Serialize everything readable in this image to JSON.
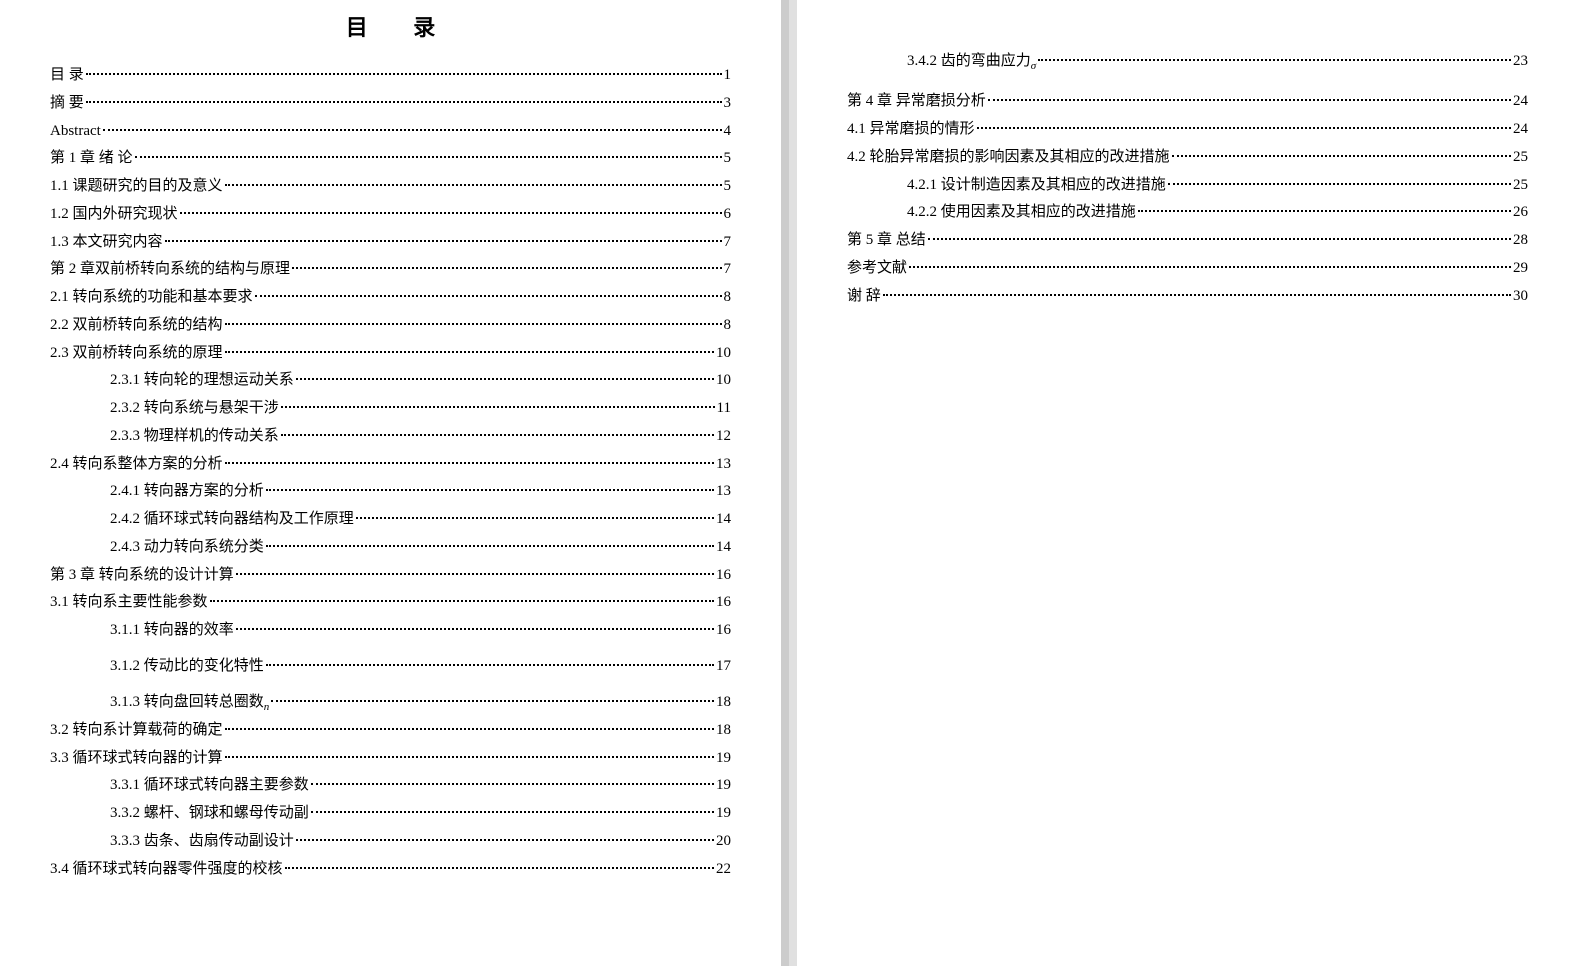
{
  "toc_title": "目 录",
  "left_page": [
    {
      "level": 1,
      "label": "目  录",
      "page": "1"
    },
    {
      "level": 1,
      "label": "摘  要",
      "page": "3"
    },
    {
      "level": 1,
      "label": "Abstract",
      "page": "4",
      "en": true
    },
    {
      "level": 1,
      "label": "第 1 章  绪  论",
      "page": "5"
    },
    {
      "level": 1,
      "label": "1.1 课题研究的目的及意义",
      "page": "5"
    },
    {
      "level": 1,
      "label": "1.2 国内外研究现状",
      "page": "6"
    },
    {
      "level": 1,
      "label": "1.3 本文研究内容",
      "page": "7"
    },
    {
      "level": 1,
      "label": "第 2 章双前桥转向系统的结构与原理",
      "page": "7"
    },
    {
      "level": 1,
      "label": "2.1 转向系统的功能和基本要求",
      "page": "8"
    },
    {
      "level": 1,
      "label": "2.2  双前桥转向系统的结构",
      "page": "8"
    },
    {
      "level": 1,
      "label": "2.3 双前桥转向系统的原理",
      "page": "10"
    },
    {
      "level": 2,
      "label": "2.3.1 转向轮的理想运动关系",
      "page": "10"
    },
    {
      "level": 2,
      "label": "2.3.2 转向系统与悬架干涉",
      "page": "11"
    },
    {
      "level": 2,
      "label": "2.3.3 物理样机的传动关系",
      "page": "12"
    },
    {
      "level": 1,
      "label": "2.4 转向系整体方案的分析",
      "page": "13"
    },
    {
      "level": 2,
      "label": "2.4.1 转向器方案的分析",
      "page": "13"
    },
    {
      "level": 2,
      "label": "2.4.2 循环球式转向器结构及工作原理",
      "page": "14"
    },
    {
      "level": 2,
      "label": "2.4.3 动力转向系统分类",
      "page": "14"
    },
    {
      "level": 1,
      "label": "第 3 章  转向系统的设计计算",
      "page": "16"
    },
    {
      "level": 1,
      "label": "3.1 转向系主要性能参数",
      "page": "16"
    },
    {
      "level": 2,
      "label": "3.1.1 转向器的效率",
      "page": "16"
    },
    {
      "level": 2,
      "label": "3.1.2 传动比的变化特性",
      "page": "17",
      "extra_margin": true
    },
    {
      "level": 2,
      "label": "3.1.3 转向盘回转总圈数",
      "sub": "n",
      "page": "18",
      "extra_margin": true
    },
    {
      "level": 1,
      "label": "3.2 转向系计算载荷的确定",
      "page": "18"
    },
    {
      "level": 1,
      "label": "3.3 循环球式转向器的计算",
      "page": "19"
    },
    {
      "level": 2,
      "label": "3.3.1 循环球式转向器主要参数",
      "page": "19"
    },
    {
      "level": 2,
      "label": "3.3.2 螺杆、钢球和螺母传动副",
      "page": "19"
    },
    {
      "level": 2,
      "label": "3.3.3 齿条、齿扇传动副设计",
      "page": "20"
    },
    {
      "level": 1,
      "label": "3.4 循环球式转向器零件强度的校核",
      "page": "22"
    }
  ],
  "right_page": [
    {
      "level": 2,
      "label": "3.4.2 齿的弯曲应力",
      "sub": "σ",
      "page": "23",
      "extra_margin": true
    },
    {
      "level": 1,
      "label": "第 4 章  异常磨损分析",
      "page": "24",
      "top_margin": true
    },
    {
      "level": 1,
      "label": "4.1 异常磨损的情形",
      "page": "24"
    },
    {
      "level": 1,
      "label": "4.2 轮胎异常磨损的影响因素及其相应的改进措施",
      "page": "25"
    },
    {
      "level": 2,
      "label": "4.2.1 设计制造因素及其相应的改进措施",
      "page": "25"
    },
    {
      "level": 2,
      "label": "4.2.2 使用因素及其相应的改进措施",
      "page": "26"
    },
    {
      "level": 1,
      "label": "第 5 章  总结",
      "page": "28"
    },
    {
      "level": 1,
      "label": "参考文献",
      "page": "29"
    },
    {
      "level": 1,
      "label": "谢  辞",
      "page": "30"
    }
  ]
}
